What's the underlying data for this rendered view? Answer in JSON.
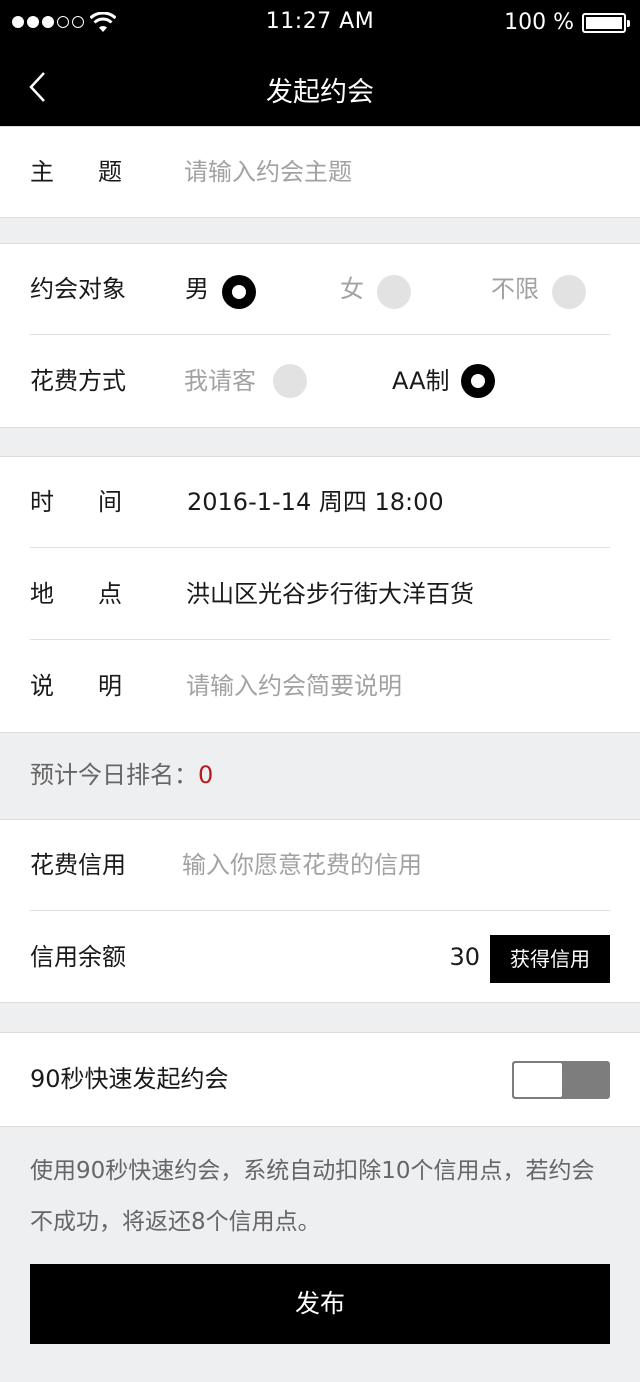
{
  "status_bar": {
    "time": "11:27 AM",
    "battery_percent": "100 %",
    "signal_bars_filled": 3,
    "signal_bars_total": 5
  },
  "nav": {
    "title": "发起约会",
    "back_icon": "chevron-left-icon"
  },
  "topic": {
    "label": "主题",
    "placeholder": "请输入约会主题"
  },
  "target": {
    "label": "约会对象",
    "options": [
      {
        "label": "男",
        "selected": true
      },
      {
        "label": "女",
        "selected": false
      },
      {
        "label": "不限",
        "selected": false
      }
    ]
  },
  "payment": {
    "label": "花费方式",
    "options": [
      {
        "label": "我请客",
        "selected": false
      },
      {
        "label": "AA制",
        "selected": true
      }
    ]
  },
  "time": {
    "label": "时间",
    "value": "2016-1-14 周四 18:00"
  },
  "place": {
    "label": "地点",
    "value": "洪山区光谷步行街大洋百货"
  },
  "description": {
    "label": "说明",
    "placeholder": "请输入约会简要说明"
  },
  "ranking": {
    "label": "预计今日排名：",
    "value": "0"
  },
  "spend_credit": {
    "label": "花费信用",
    "placeholder": "输入你愿意花费的信用"
  },
  "credit_balance": {
    "label": "信用余额",
    "value": "30",
    "button_label": "获得信用"
  },
  "quick": {
    "label": "90秒快速发起约会",
    "toggle_on": false
  },
  "note": "使用90秒快速约会，系统自动扣除10个信用点，若约会不成功，将返还8个信用点。",
  "publish_label": "发布",
  "colors": {
    "primary": "#000000",
    "background": "#eeeff1",
    "placeholder": "#a2a2a2",
    "rank_value": "#b81c1c",
    "radio_off": "#e2e2e2"
  }
}
